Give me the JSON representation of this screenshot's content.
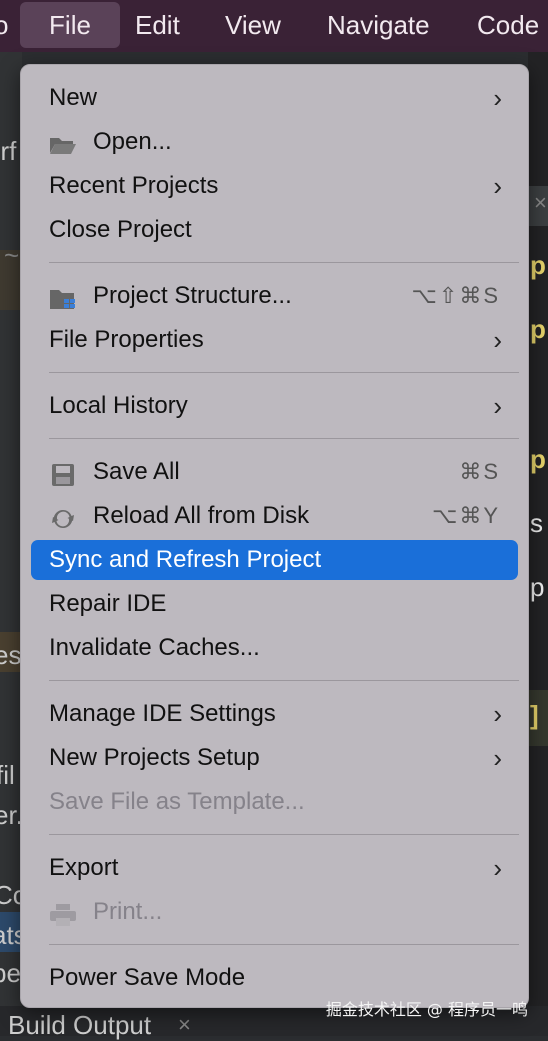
{
  "menubar": {
    "partial_left": "o",
    "items": [
      "File",
      "Edit",
      "View",
      "Navigate",
      "Code"
    ]
  },
  "background": {
    "left_fragments": [
      "erf",
      "~",
      "es",
      "fil",
      "er.",
      "Co",
      "ats",
      "be"
    ],
    "right_fragments": [
      "p",
      "p",
      "p",
      "s",
      "p",
      "]"
    ],
    "tab_close": "×",
    "bottom_tab": "Build Output",
    "bottom_tab_close": "×"
  },
  "menu": {
    "new": "New",
    "open": "Open...",
    "recent_projects": "Recent Projects",
    "close_project": "Close Project",
    "project_structure": "Project Structure...",
    "project_structure_shortcut": "⌥⇧⌘S",
    "file_properties": "File Properties",
    "local_history": "Local History",
    "save_all": "Save All",
    "save_all_shortcut": "⌘S",
    "reload": "Reload All from Disk",
    "reload_shortcut": "⌥⌘Y",
    "sync": "Sync and Refresh Project",
    "repair": "Repair IDE",
    "invalidate": "Invalidate Caches...",
    "manage_settings": "Manage IDE Settings",
    "new_projects_setup": "New Projects Setup",
    "save_template": "Save File as Template...",
    "export": "Export",
    "print": "Print...",
    "power_save": "Power Save Mode",
    "chevron": "›"
  },
  "watermark": "掘金技术社区 @ 程序员一鸣",
  "colors": {
    "menubar": "#3a2236",
    "menu_bg": "#bdb9bf",
    "selection": "#1a6fd9"
  }
}
